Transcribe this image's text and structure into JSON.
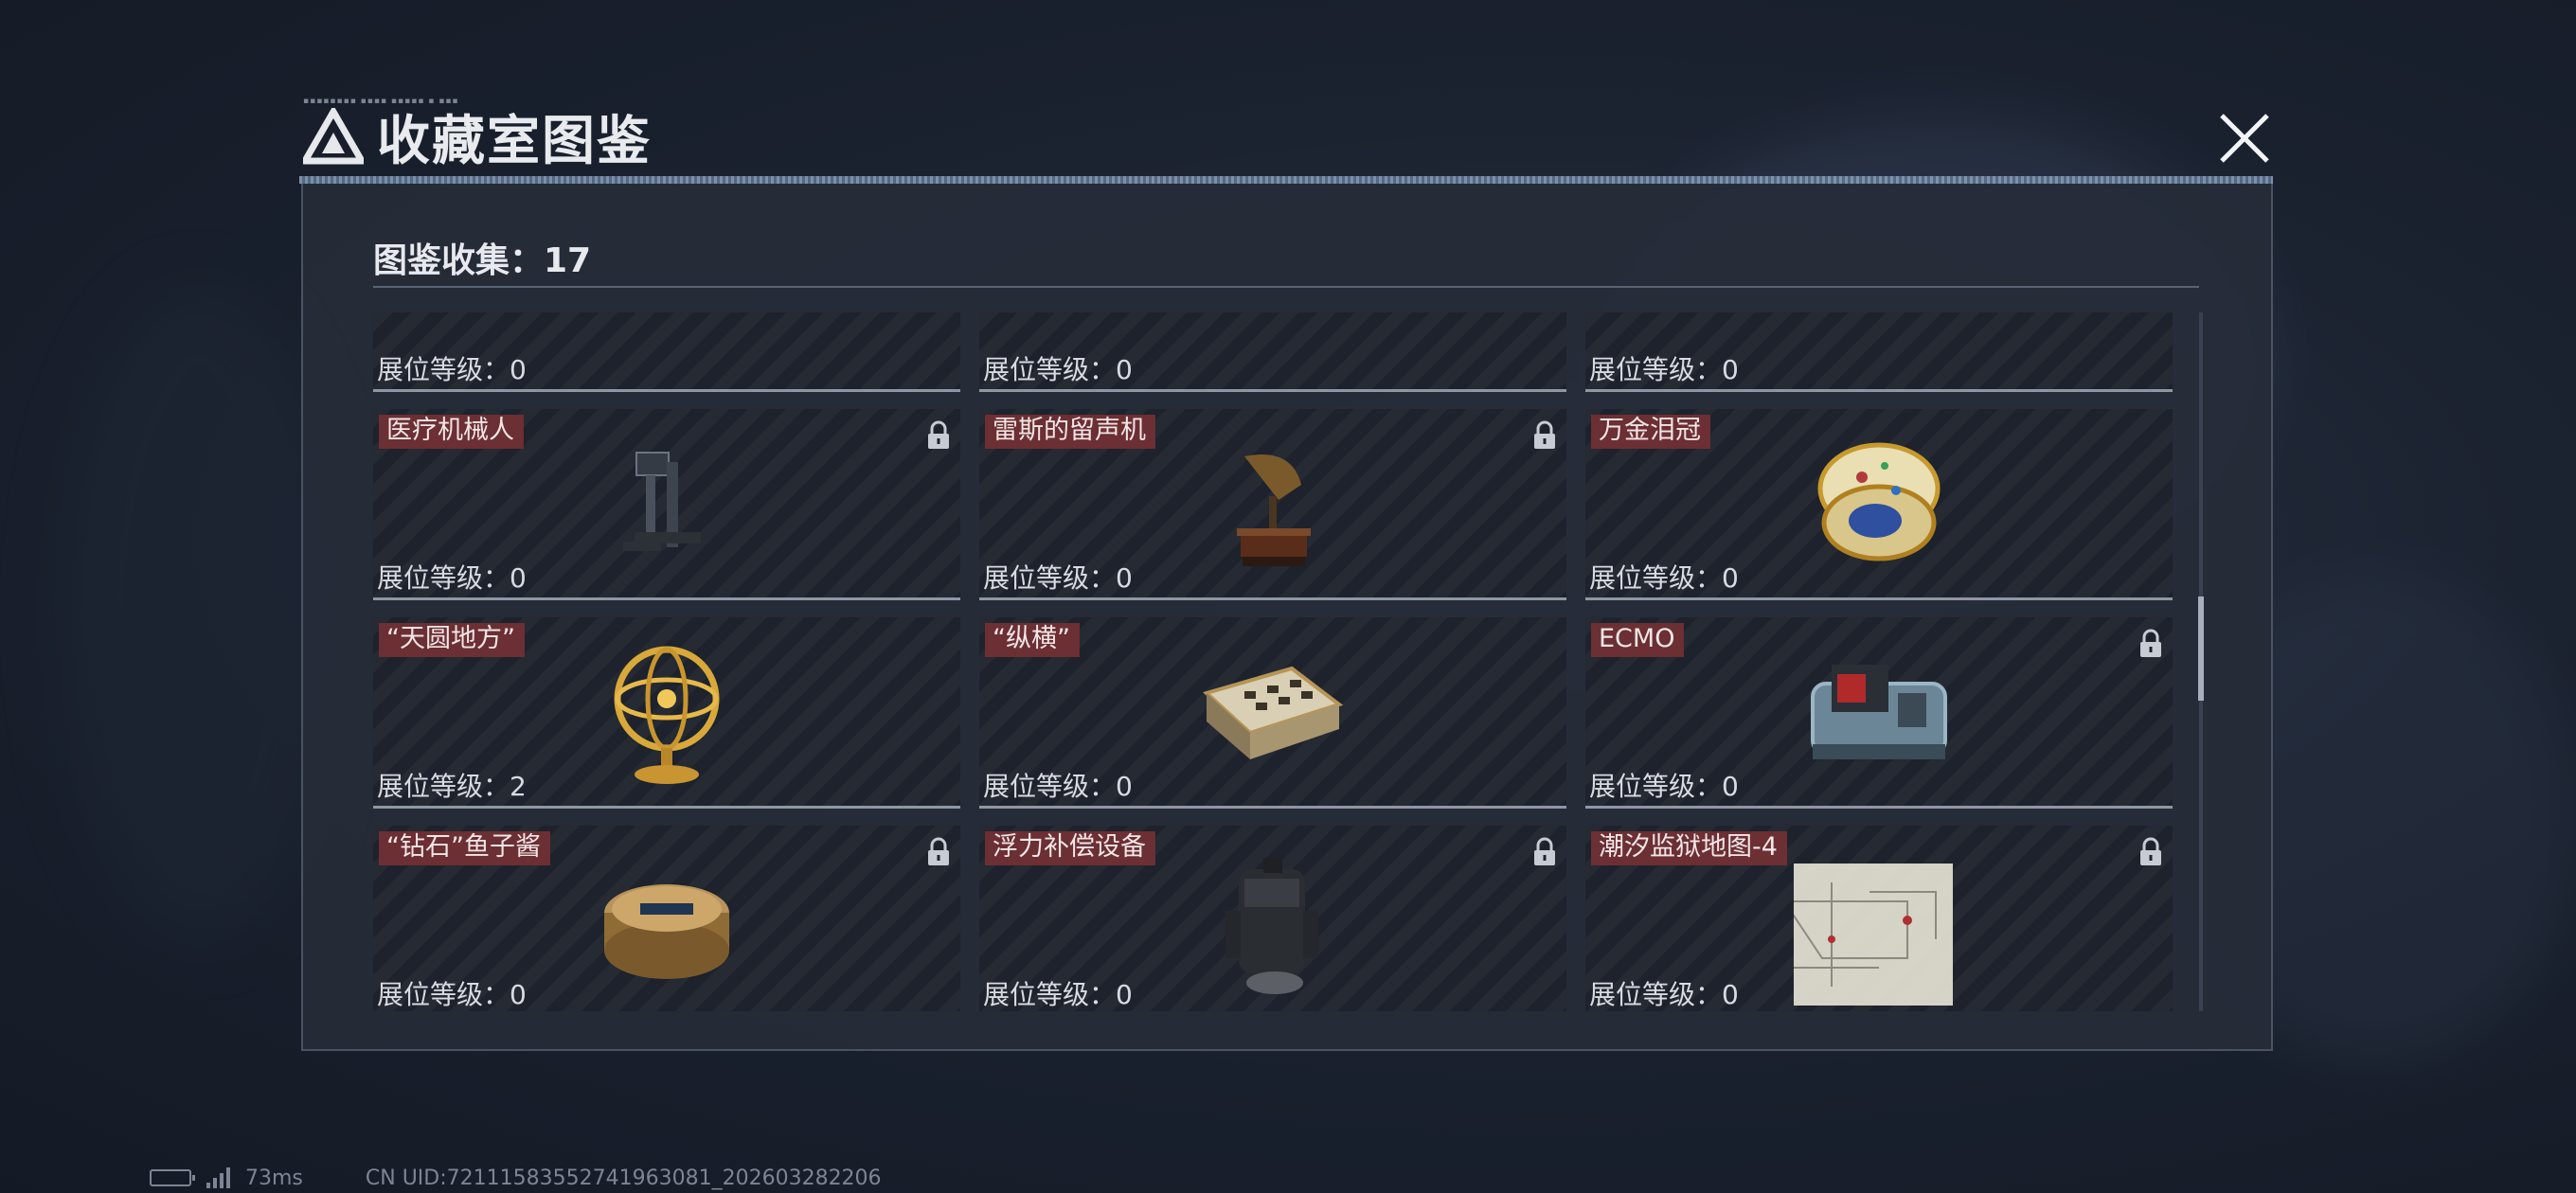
{
  "window": {
    "title": "收藏室图鉴",
    "close_icon": "close-icon"
  },
  "panel": {
    "count_label": "图鉴收集：17"
  },
  "cards": [
    {
      "name": "",
      "level": "展位等级：0",
      "locked": false,
      "art": "clock-machine"
    },
    {
      "name": "",
      "level": "展位等级：0",
      "locked": false,
      "art": "grey-box"
    },
    {
      "name": "",
      "level": "展位等级：0",
      "locked": false,
      "art": "ornate-panel"
    },
    {
      "name": "医疗机械人",
      "level": "展位等级：0",
      "locked": true,
      "art": "medical-robot"
    },
    {
      "name": "雷斯的留声机",
      "level": "展位等级：0",
      "locked": true,
      "art": "gramophone"
    },
    {
      "name": "万金泪冠",
      "level": "展位等级：0",
      "locked": false,
      "art": "jeweled-egg"
    },
    {
      "name": "“天圆地方”",
      "level": "展位等级：2",
      "locked": false,
      "art": "armillary-sphere"
    },
    {
      "name": "“纵横”",
      "level": "展位等级：0",
      "locked": false,
      "art": "chess-box"
    },
    {
      "name": "ECMO",
      "level": "展位等级：0",
      "locked": true,
      "art": "ecmo-machine"
    },
    {
      "name": "“钻石”鱼子酱",
      "level": "展位等级：0",
      "locked": true,
      "art": "caviar-tin"
    },
    {
      "name": "浮力补偿设备",
      "level": "展位等级：0",
      "locked": true,
      "art": "buoyancy-device"
    },
    {
      "name": "潮汐监狱地图-4",
      "level": "展位等级：0",
      "locked": true,
      "art": "prison-map"
    }
  ],
  "status": {
    "ping": "73ms",
    "uid": "CN UID:72111583552741963081_202603282206"
  },
  "colors": {
    "tag_bg": "#6b2f34",
    "panel_bg": "#262c38",
    "accent_rule": "#8ea3bf"
  }
}
